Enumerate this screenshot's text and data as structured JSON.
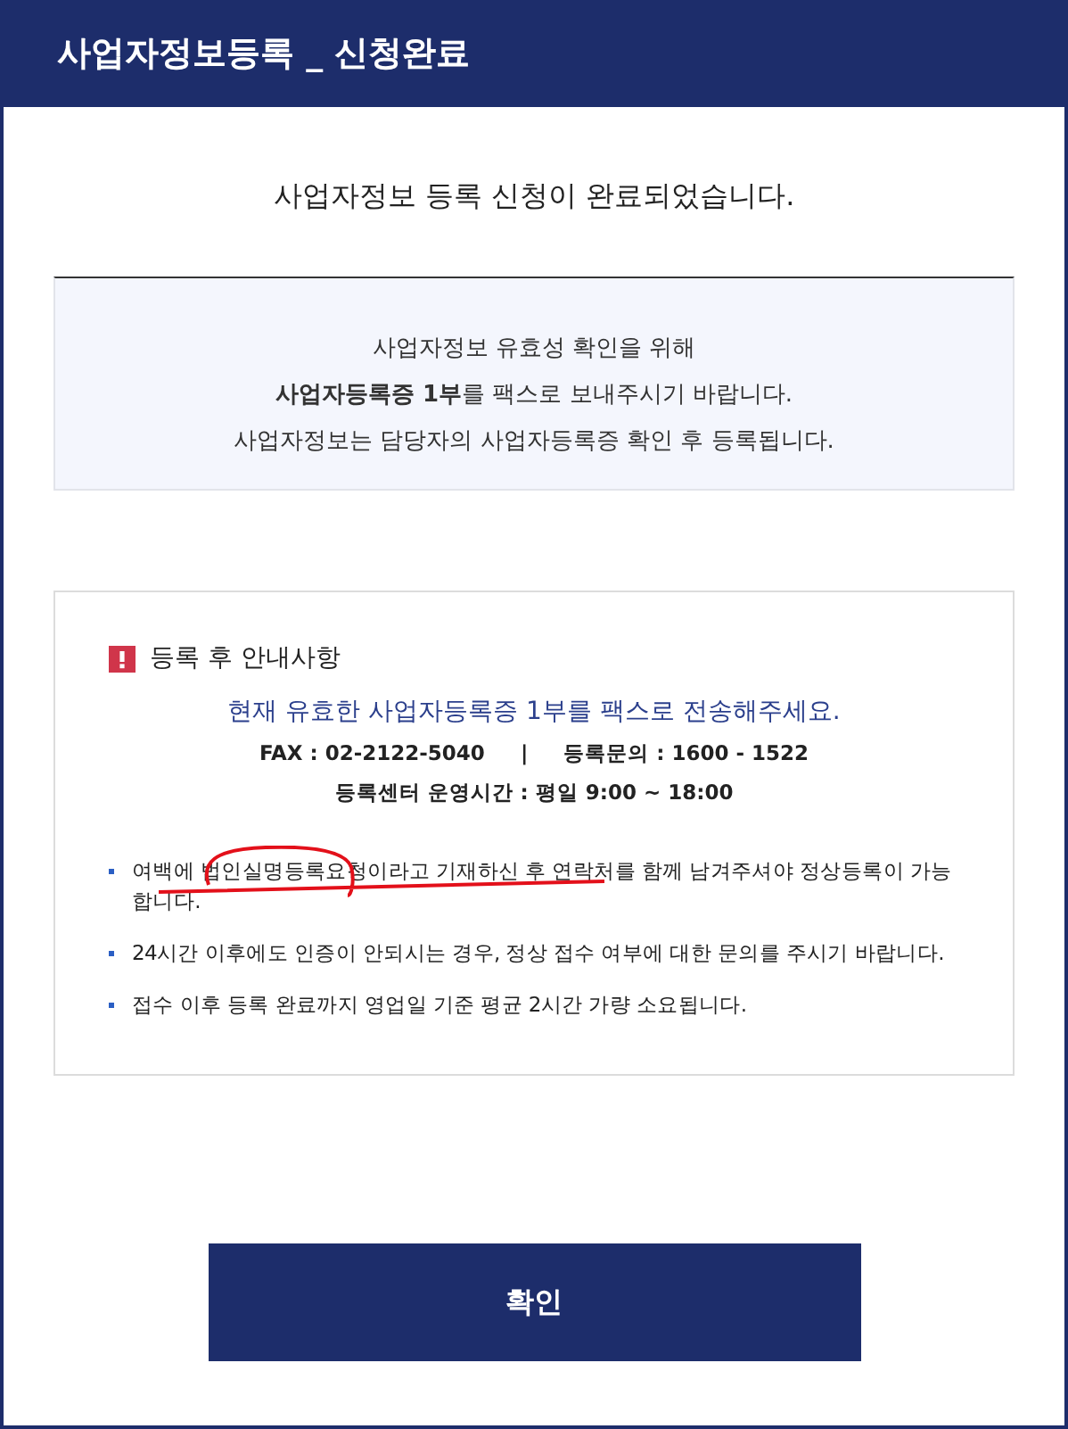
{
  "window": {
    "title": "사업자정보등록 _ 신청완료"
  },
  "heading": "사업자정보 등록 신청이 완료되었습니다.",
  "info_lines": [
    "사업자정보 유효성 확인을 위해",
    "**사업자등록증 1부**를 팩스로 보내주시기 바랍니다.",
    "사업자정보는 담당자의 사업자등록증 확인 후 등록됩니다."
  ],
  "notice": {
    "title": "등록 후 안내사항",
    "highlight": "현재 유효한 사업자등록증 1부를 팩스로 전송해주세요.",
    "fax": "FAX : 02-2122-5040",
    "separator": "|",
    "inquiry": "등록문의 : 1600 - 1522",
    "hours": "등록센터 운영시간 : 평일 9:00 ~ 18:00",
    "bullets": [
      {
        "text": "여백에 법인실명등록요청이라고 기재하신 후 연락처를 함께 남겨주셔야 정상등록이 가능합니다.",
        "annotated": true
      },
      {
        "text": "24시간 이후에도 인증이 안되시는 경우, 정상 접수 여부에 대한 문의를 주시기 바랍니다.",
        "annotated": false
      },
      {
        "text": "접수 이후 등록 완료까지 영업일 기준 평균 2시간 가량 소요됩니다.",
        "annotated": false
      }
    ]
  },
  "buttons": [
    "확인"
  ]
}
